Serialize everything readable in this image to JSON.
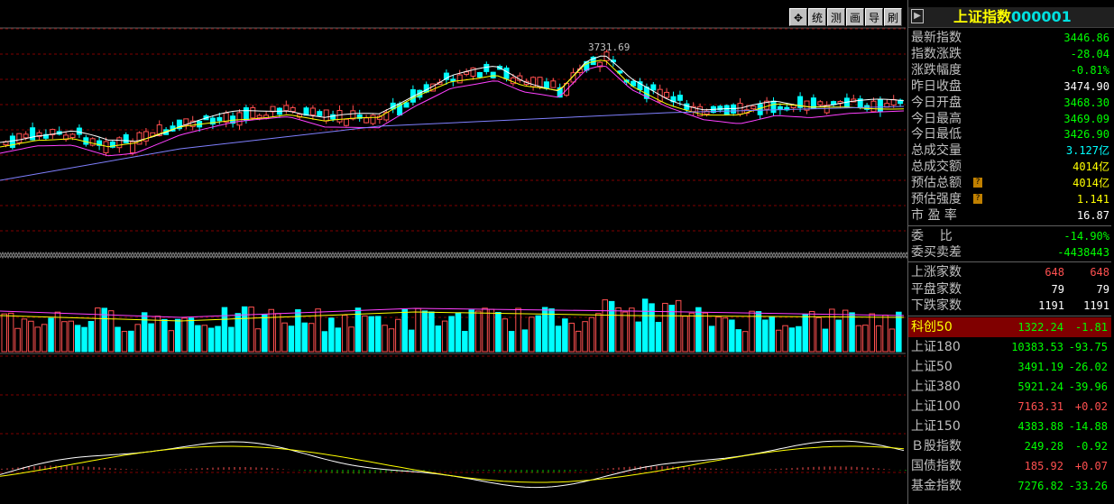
{
  "toolbar": {
    "buttons": [
      "✥",
      "统",
      "测",
      "画",
      "导",
      "刷"
    ]
  },
  "chart": {
    "peak_label": "3731.69"
  },
  "panel": {
    "collapse_icon": "▶",
    "title": "上证指数",
    "code": "000001",
    "stats": [
      {
        "label": "最新指数",
        "value": "3446.86",
        "cls": "down"
      },
      {
        "label": "指数涨跌",
        "value": "-28.04",
        "cls": "down"
      },
      {
        "label": "涨跌幅度",
        "value": "-0.81%",
        "cls": "down"
      },
      {
        "label": "昨日收盘",
        "value": "3474.90",
        "cls": "wht"
      },
      {
        "label": "今日开盘",
        "value": "3468.30",
        "cls": "down"
      },
      {
        "label": "今日最高",
        "value": "3469.09",
        "cls": "down"
      },
      {
        "label": "今日最低",
        "value": "3426.90",
        "cls": "down"
      },
      {
        "label": "总成交量",
        "value": "3.127亿",
        "cls": "cyan"
      },
      {
        "label": "总成交额",
        "value": "4014亿",
        "cls": "yel"
      },
      {
        "label": "预估总额",
        "value": "4014亿",
        "cls": "yel",
        "help": "?"
      },
      {
        "label": "预估强度",
        "value": "1.141",
        "cls": "yel",
        "help": "?"
      },
      {
        "label": "市 盈 率",
        "value": "16.87",
        "cls": "wht"
      }
    ],
    "order_stats": [
      {
        "label": "委    比",
        "value": "-14.90%",
        "cls": "down"
      },
      {
        "label": "委买卖差",
        "value": "-4438443",
        "cls": "down"
      }
    ],
    "breadth": [
      {
        "label": "上涨家数",
        "v1": "648",
        "v2": "648",
        "cls": "up"
      },
      {
        "label": "平盘家数",
        "v1": "79",
        "v2": "79",
        "cls": "wht"
      },
      {
        "label": "下跌家数",
        "v1": "1191",
        "v2": "1191",
        "cls": "wht"
      }
    ],
    "indices": [
      {
        "label": "科创50",
        "price": "1322.24",
        "change": "-1.81",
        "pcls": "down",
        "ccls": "down"
      },
      {
        "label": "上证180",
        "price": "10383.53",
        "change": "-93.75",
        "pcls": "down",
        "ccls": "down"
      },
      {
        "label": "上证50",
        "price": "3491.19",
        "change": "-26.02",
        "pcls": "down",
        "ccls": "down"
      },
      {
        "label": "上证380",
        "price": "5921.24",
        "change": "-39.96",
        "pcls": "down",
        "ccls": "down"
      },
      {
        "label": "上证100",
        "price": "7163.31",
        "change": "+0.02",
        "pcls": "up",
        "ccls": "up"
      },
      {
        "label": "上证150",
        "price": "4383.88",
        "change": "-14.88",
        "pcls": "down",
        "ccls": "down"
      },
      {
        "label": "Ｂ股指数",
        "price": "249.28",
        "change": "-0.92",
        "pcls": "down",
        "ccls": "down"
      },
      {
        "label": "国债指数",
        "price": "185.92",
        "change": "+0.07",
        "pcls": "up",
        "ccls": "up"
      },
      {
        "label": "基金指数",
        "price": "7276.82",
        "change": "-33.26",
        "pcls": "down",
        "ccls": "down"
      }
    ]
  },
  "colors": {
    "up": "#ff5050",
    "down": "#00ffff",
    "ma5": "#ffffff",
    "ma10": "#ffff00",
    "ma20": "#ff40ff",
    "ma60": "#8080ff",
    "grid": "#800000"
  }
}
